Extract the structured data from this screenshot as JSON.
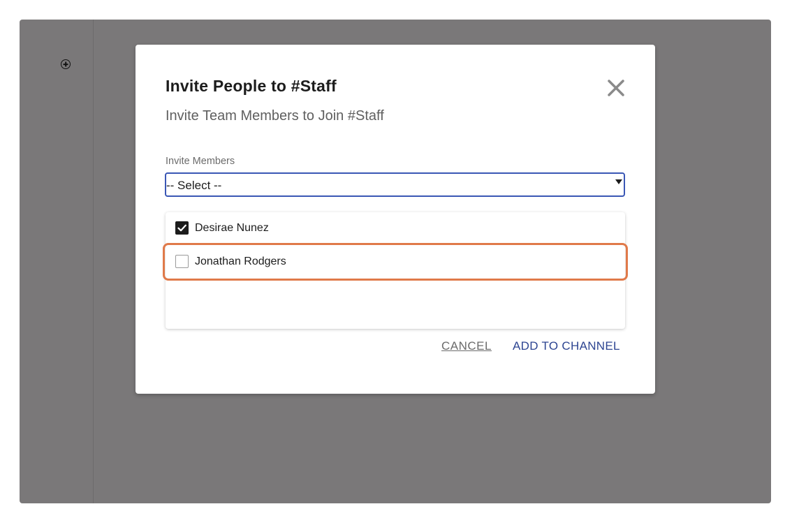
{
  "modal": {
    "title": "Invite People to #Staff",
    "subtitle": "Invite Team Members to Join #Staff",
    "close_icon": "close-icon"
  },
  "members_field": {
    "label": "Invite Members",
    "selected_value": "-- Select --"
  },
  "options": [
    {
      "label": "Desirae Nunez",
      "checked": true
    },
    {
      "label": "Jonathan Rodgers",
      "checked": false
    }
  ],
  "actions": {
    "cancel_label": "CANCEL",
    "add_label": "ADD TO CHANNEL"
  },
  "colors": {
    "overlay": "#7a7879",
    "accent": "#3a57b5",
    "primary_action": "#2d4592",
    "highlight": "#e07a4a"
  },
  "icons": {
    "sidebar_add": "add-circle-icon"
  }
}
